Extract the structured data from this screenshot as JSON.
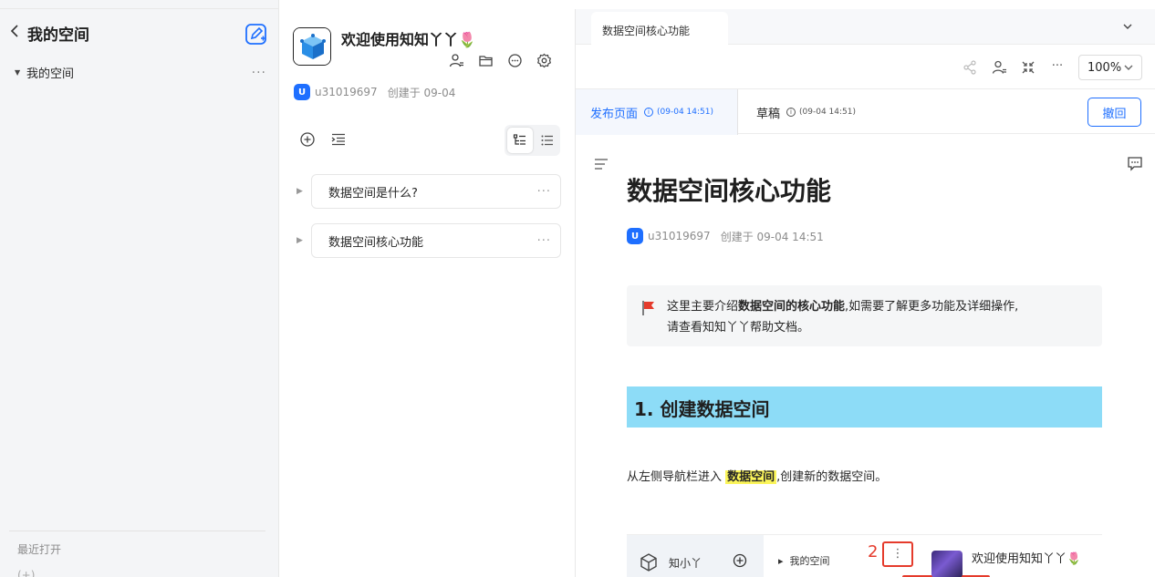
{
  "sidebar": {
    "title": "我的空间",
    "tree_item": "我的空间",
    "more": "···",
    "recent_label": "最近打开",
    "bottom_stub": "(+)"
  },
  "kb": {
    "title": "欢迎使用知知丫丫🌷",
    "avatar_letter": "U",
    "user": "u31019697",
    "created": "创建于 09-04",
    "docs": [
      {
        "title": "数据空间是什么?",
        "more": "···"
      },
      {
        "title": "数据空间核心功能",
        "more": "···"
      }
    ]
  },
  "editor": {
    "tab_label": "数据空间核心功能",
    "zoom": "100%",
    "published_label": "发布页面",
    "published_time": "(09-04 14:51)",
    "draft_label": "草稿",
    "draft_time": "(09-04 14:51)",
    "revoke_label": "撤回",
    "more": "···",
    "doc": {
      "title": "数据空间核心功能",
      "avatar_letter": "U",
      "user": "u31019697",
      "created": "创建于 09-04 14:51",
      "callout_prefix": "这里主要介绍",
      "callout_bold": "数据空间的核心功能",
      "callout_suffix": ",如需要了解更多功能及详细操作,",
      "callout_line2": "请查看知知丫丫帮助文档。",
      "h1": "1. 创建数据空间",
      "para_prefix": "从左侧导航栏进入",
      "para_highlight": "数据空间",
      "para_suffix": ",创建新的数据空间。"
    },
    "embed": {
      "app_name": "知小丫",
      "space": "我的空间",
      "step": "2",
      "menu_dots": "⋮",
      "welcome": "欢迎使用知知丫丫🌷"
    }
  },
  "colors": {
    "accent": "#1e6fff",
    "heading_bg": "#8ddcf7",
    "highlight": "#fbf55a",
    "annotation_red": "#e53b2c"
  }
}
